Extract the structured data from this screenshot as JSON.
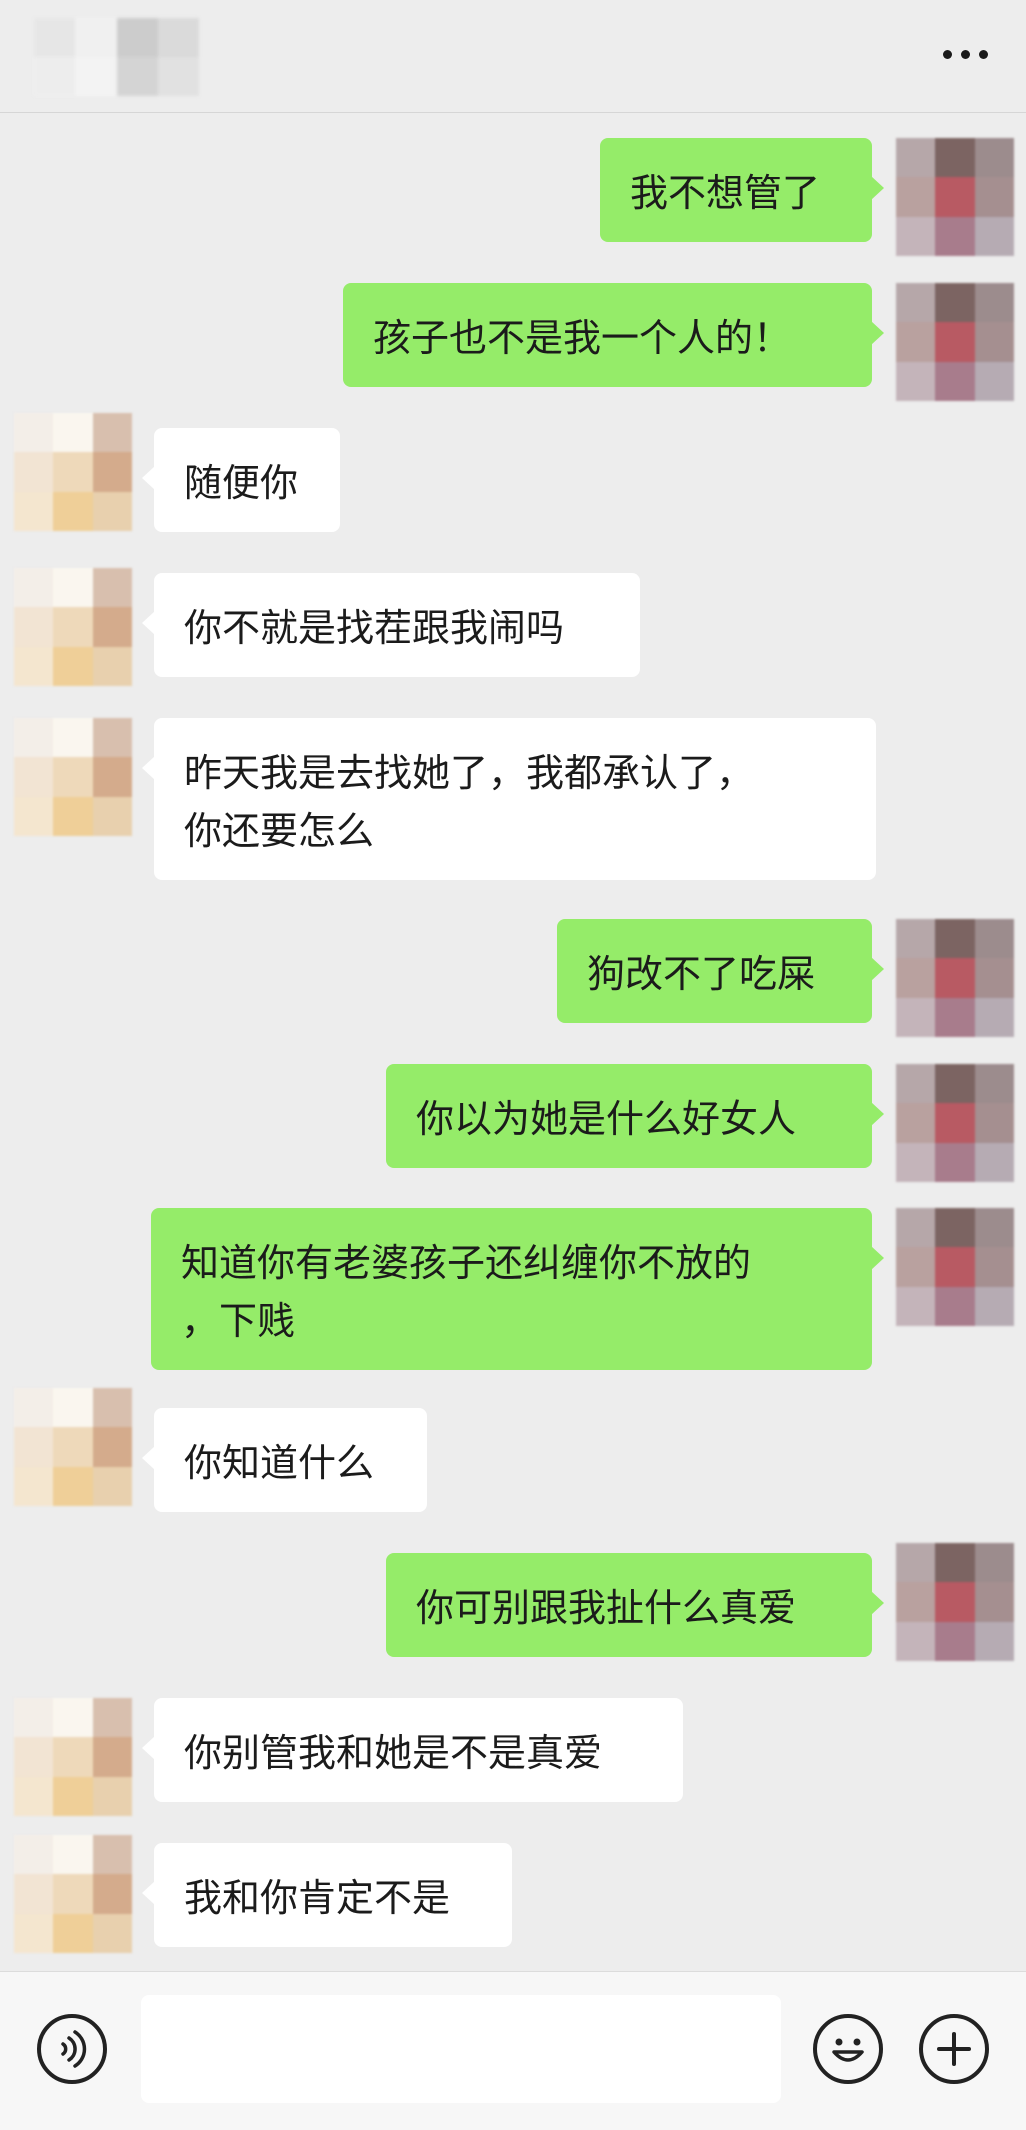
{
  "header": {
    "contact_name": "",
    "more_icon": "more-dots-icon"
  },
  "messages": [
    {
      "side": "me",
      "text": "我不想管了"
    },
    {
      "side": "me",
      "text": "孩子也不是我一个人的！"
    },
    {
      "side": "them",
      "text": "随便你"
    },
    {
      "side": "them",
      "text": "你不就是找茬跟我闹吗"
    },
    {
      "side": "them",
      "text": "昨天我是去找她了，我都承认了，\n你还要怎么"
    },
    {
      "side": "me",
      "text": "狗改不了吃屎"
    },
    {
      "side": "me",
      "text": "你以为她是什么好女人"
    },
    {
      "side": "me",
      "text": "知道你有老婆孩子还纠缠你不放的\n，下贱"
    },
    {
      "side": "them",
      "text": "你知道什么"
    },
    {
      "side": "me",
      "text": "你可别跟我扯什么真爱"
    },
    {
      "side": "them",
      "text": "你别管我和她是不是真爱"
    },
    {
      "side": "them",
      "text": "我和你肯定不是"
    }
  ],
  "input_bar": {
    "voice_icon": "voice-icon",
    "message_value": "",
    "emoji_icon": "emoji-icon",
    "plus_icon": "plus-icon"
  },
  "colors": {
    "background": "#ededed",
    "my_bubble": "#95ec69",
    "their_bubble": "#ffffff",
    "text": "#1b1b1b"
  }
}
